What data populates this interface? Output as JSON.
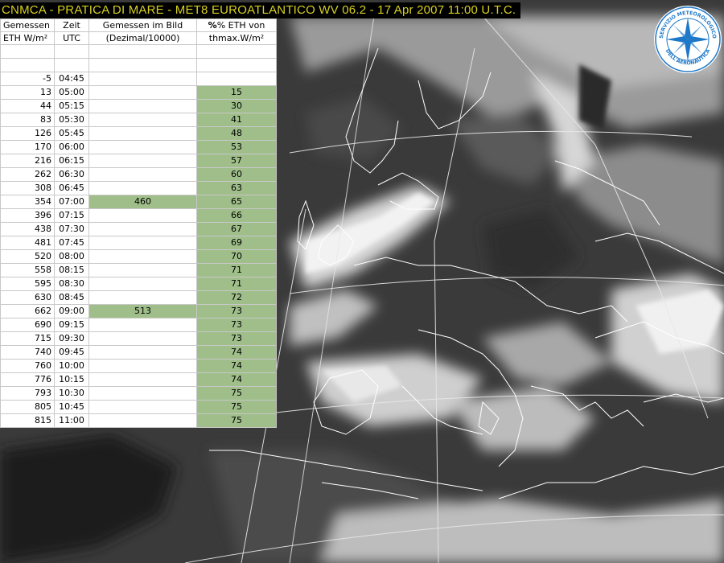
{
  "title": "CNMCA - PRATICA DI MARE - MET8 EUROATLANTICO WV 06.2 - 17 Apr 2007 11:00 U.T.C.",
  "table": {
    "headers": [
      [
        "Gemessen",
        "Zeit",
        "Gemessen im Bild",
        "% ETH von"
      ],
      [
        "ETH W/m²",
        "UTC",
        "(Dezimal/10000)",
        "thmax.W/m²"
      ]
    ],
    "rows": [
      {
        "eth": "",
        "time": "",
        "image": "",
        "pct": ""
      },
      {
        "eth": "",
        "time": "",
        "image": "",
        "pct": ""
      },
      {
        "eth": "-5",
        "time": "04:45",
        "image": "",
        "pct": ""
      },
      {
        "eth": "13",
        "time": "05:00",
        "image": "",
        "pct": "15"
      },
      {
        "eth": "44",
        "time": "05:15",
        "image": "",
        "pct": "30"
      },
      {
        "eth": "83",
        "time": "05:30",
        "image": "",
        "pct": "41"
      },
      {
        "eth": "126",
        "time": "05:45",
        "image": "",
        "pct": "48"
      },
      {
        "eth": "170",
        "time": "06:00",
        "image": "",
        "pct": "53"
      },
      {
        "eth": "216",
        "time": "06:15",
        "image": "",
        "pct": "57"
      },
      {
        "eth": "262",
        "time": "06:30",
        "image": "",
        "pct": "60"
      },
      {
        "eth": "308",
        "time": "06:45",
        "image": "",
        "pct": "63"
      },
      {
        "eth": "354",
        "time": "07:00",
        "image": "460",
        "pct": "65"
      },
      {
        "eth": "396",
        "time": "07:15",
        "image": "",
        "pct": "66"
      },
      {
        "eth": "438",
        "time": "07:30",
        "image": "",
        "pct": "67"
      },
      {
        "eth": "481",
        "time": "07:45",
        "image": "",
        "pct": "69"
      },
      {
        "eth": "520",
        "time": "08:00",
        "image": "",
        "pct": "70"
      },
      {
        "eth": "558",
        "time": "08:15",
        "image": "",
        "pct": "71"
      },
      {
        "eth": "595",
        "time": "08:30",
        "image": "",
        "pct": "71"
      },
      {
        "eth": "630",
        "time": "08:45",
        "image": "",
        "pct": "72"
      },
      {
        "eth": "662",
        "time": "09:00",
        "image": "513",
        "pct": "73"
      },
      {
        "eth": "690",
        "time": "09:15",
        "image": "",
        "pct": "73"
      },
      {
        "eth": "715",
        "time": "09:30",
        "image": "",
        "pct": "73"
      },
      {
        "eth": "740",
        "time": "09:45",
        "image": "",
        "pct": "74"
      },
      {
        "eth": "760",
        "time": "10:00",
        "image": "",
        "pct": "74"
      },
      {
        "eth": "776",
        "time": "10:15",
        "image": "",
        "pct": "74"
      },
      {
        "eth": "793",
        "time": "10:30",
        "image": "",
        "pct": "75"
      },
      {
        "eth": "805",
        "time": "10:45",
        "image": "",
        "pct": "75"
      },
      {
        "eth": "815",
        "time": "11:00",
        "image": "",
        "pct": "75"
      }
    ]
  },
  "logo": {
    "text": "SERVIZIO METEOROLOGICO DELL'AERONAUTICA",
    "icon": "compass-rose-icon"
  },
  "colors": {
    "title_text": "#d8d020",
    "title_bg": "#000000",
    "highlight": "#9fbe8a",
    "coastline": "#ffffff",
    "logo": "#1e78c8"
  }
}
